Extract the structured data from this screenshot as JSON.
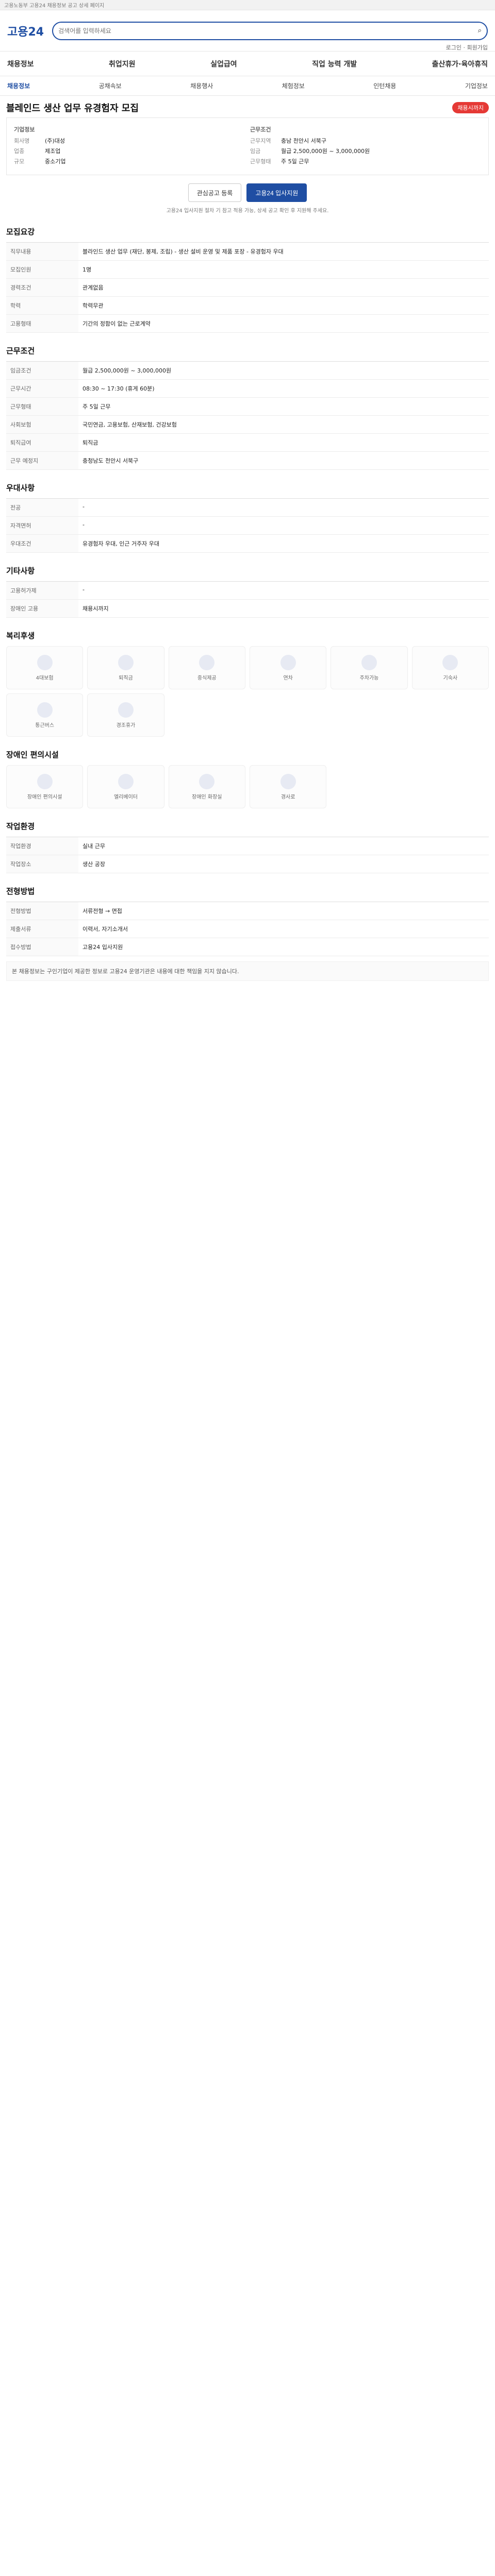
{
  "topbar": {
    "text": "고용노동부 고용24 채용정보 공고 상세 페이지"
  },
  "header": {
    "logo": "고용24",
    "search_placeholder": "검색어를 입력하세요",
    "util": "로그인 · 회원가입"
  },
  "gnb": {
    "items": [
      "채용정보",
      "취업지원",
      "실업급여",
      "직업 능력 개발",
      "출산휴가·육아휴직"
    ]
  },
  "subnav": {
    "items": [
      "채용정보",
      "공채속보",
      "채용행사",
      "체험정보",
      "인턴채용",
      "기업정보"
    ],
    "active_index": 0
  },
  "job": {
    "title": "블레인드 생산 업무 유경험자 모집",
    "dday": "채용시까지",
    "company_heading": "기업정보",
    "company_rows": [
      {
        "k": "회사명",
        "v": "(주)대성"
      },
      {
        "k": "업종",
        "v": "제조업"
      },
      {
        "k": "규모",
        "v": "중소기업"
      }
    ],
    "condition_heading": "근무조건",
    "condition_rows": [
      {
        "k": "근무지역",
        "v": "충남 천안시 서북구"
      },
      {
        "k": "임금",
        "v": "월급 2,500,000원 ~ 3,000,000원"
      },
      {
        "k": "근무형태",
        "v": "주 5일 근무"
      }
    ],
    "btn_scrap": "관심공고 등록",
    "btn_apply": "고용24 입사지원",
    "note": "고용24 입사지원 절차 기 참고 적용 가능, 상세 공고 확인 후 지원해 주세요."
  },
  "sections": {
    "recruit": "모집요강",
    "work": "근무조건",
    "prefer": "우대사항",
    "etc": "기타사항",
    "welfare": "복리후생",
    "disability": "장애인 편의시설",
    "env": "작업환경",
    "process": "전형방법"
  },
  "recruit_rows": [
    {
      "k": "직무내용",
      "v": "블라인드 생산 업무 (재단, 봉제, 조립)\n- 생산 설비 운영 및 제품 포장\n- 유경험자 우대"
    },
    {
      "k": "모집인원",
      "v": "1명"
    },
    {
      "k": "경력조건",
      "v": "관계없음"
    },
    {
      "k": "학력",
      "v": "학력무관"
    },
    {
      "k": "고용형태",
      "v": "기간의 정함이 없는 근로계약"
    }
  ],
  "work_rows": [
    {
      "k": "임금조건",
      "v": "월급 2,500,000원 ~ 3,000,000원"
    },
    {
      "k": "근무시간",
      "v": "08:30 ~ 17:30 (휴게 60분)"
    },
    {
      "k": "근무형태",
      "v": "주 5일 근무"
    },
    {
      "k": "사회보험",
      "v": "국민연금, 고용보험, 산재보험, 건강보험"
    },
    {
      "k": "퇴직급여",
      "v": "퇴직금"
    },
    {
      "k": "근무 예정지",
      "v": "충청남도 천안시 서북구"
    }
  ],
  "prefer_rows": [
    {
      "k": "전공",
      "v": "-"
    },
    {
      "k": "자격면허",
      "v": "-"
    },
    {
      "k": "우대조건",
      "v": "유경험자 우대, 인근 거주자 우대"
    }
  ],
  "etc_rows": [
    {
      "k": "고용허가제",
      "v": "-"
    },
    {
      "k": "장애인 고용",
      "v": "채용시까지"
    }
  ],
  "welfare_items": [
    "4대보험",
    "퇴직금",
    "중식제공",
    "연차",
    "주차가능",
    "기숙사",
    "통근버스",
    "경조휴가"
  ],
  "disability_items": [
    "장애인 편의시설",
    "엘리베이터",
    "장애인 화장실",
    "경사로"
  ],
  "env_rows": [
    {
      "k": "작업환경",
      "v": "실내 근무"
    },
    {
      "k": "작업장소",
      "v": "생산 공장"
    }
  ],
  "process_rows": [
    {
      "k": "전형방법",
      "v": "서류전형 → 면접"
    },
    {
      "k": "제출서류",
      "v": "이력서, 자기소개서"
    },
    {
      "k": "접수방법",
      "v": "고용24 입사지원"
    }
  ],
  "notice_text": "본 채용정보는 구인기업이 제공한 정보로 고용24 운영기관은 내용에 대한 책임을 지지 않습니다."
}
